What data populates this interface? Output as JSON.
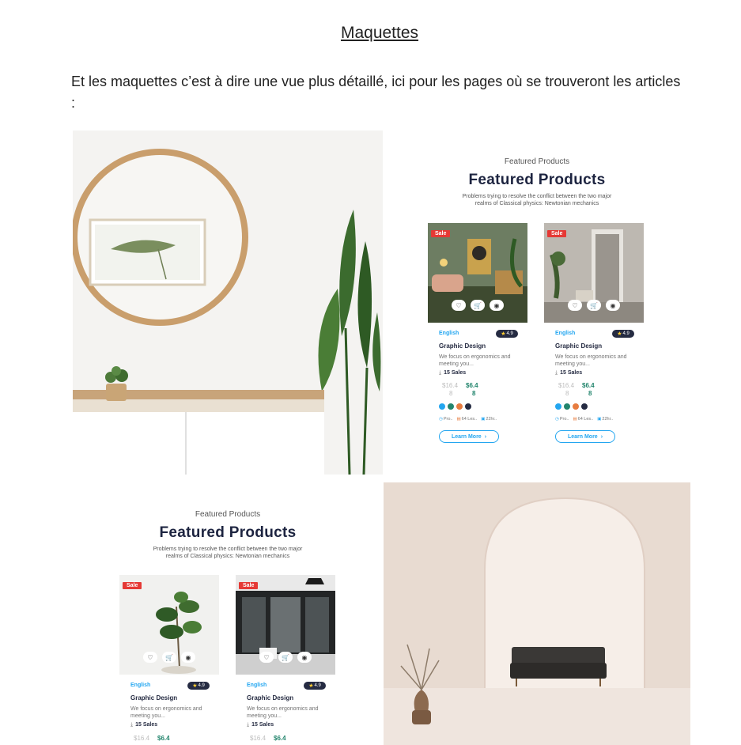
{
  "document": {
    "title": "Maquettes",
    "intro": "Et les maquettes c’est à dire une vue plus détaillé, ici pour les pages où se trouveront les articles :"
  },
  "product_section": {
    "eyebrow": "Featured Products",
    "heading": "Featured Products",
    "description": "Problems trying to resolve the conflict between the two major realms of Classical physics: Newtonian mechanics"
  },
  "card": {
    "sale_badge": "Sale",
    "category": "English",
    "rating": "4.9",
    "name": "Graphic Design",
    "text": "We focus on ergonomics and meeting you...",
    "sales": "15 Sales",
    "price_old": "$16.4",
    "price_new": "$6.4",
    "price_old2": "8",
    "price_new2": "8",
    "meta_1": "Pro..",
    "meta_2": "64 Les..",
    "meta_3": "22hr..",
    "button": "Learn More",
    "colors": [
      "#23a6f0",
      "#23856d",
      "#e77c40",
      "#252b42"
    ]
  },
  "icons": {
    "heart": "heart-icon",
    "cart": "cart-icon",
    "eye": "eye-icon",
    "star": "star-icon",
    "download": "download-icon",
    "chevron": "chevron-right-icon"
  }
}
